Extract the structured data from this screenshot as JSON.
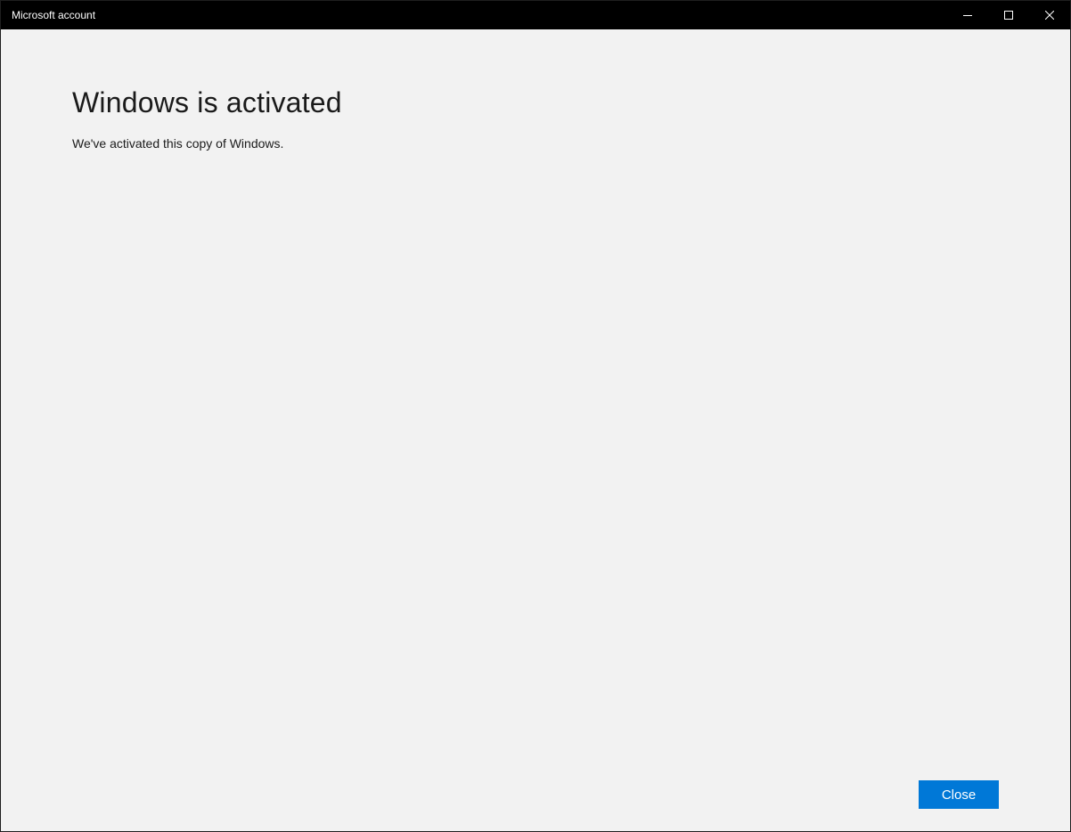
{
  "window": {
    "title": "Microsoft account",
    "controls": {
      "minimize_icon": "minimize-icon",
      "maximize_icon": "maximize-icon",
      "close_icon": "close-icon"
    }
  },
  "content": {
    "heading": "Windows is activated",
    "message": "We've activated this copy of Windows."
  },
  "footer": {
    "close_label": "Close"
  },
  "colors": {
    "titlebar_bg": "#000000",
    "content_bg": "#f2f2f2",
    "accent": "#0078d7"
  }
}
